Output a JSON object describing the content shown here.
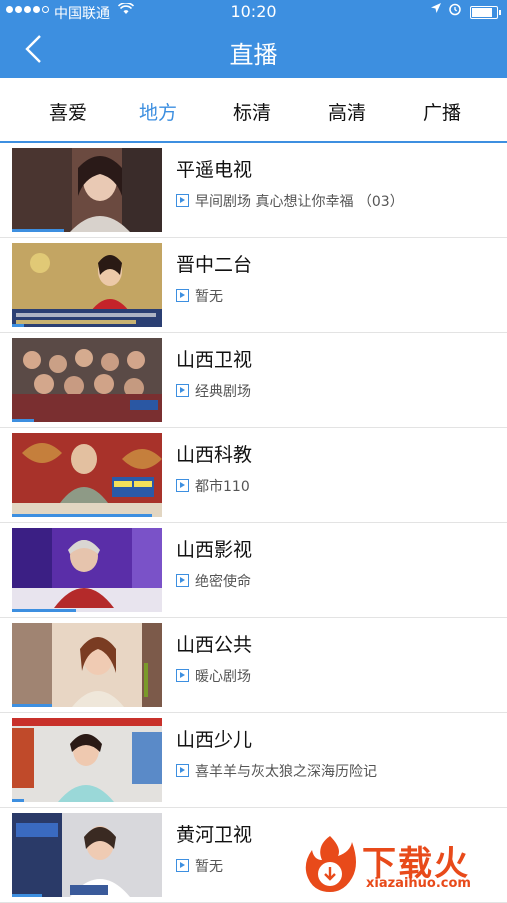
{
  "status_bar": {
    "carrier": "中国联通",
    "time": "10:20"
  },
  "header": {
    "title": "直播",
    "background": "#3d8fe0"
  },
  "tabs": [
    "喜爱",
    "地方",
    "标清",
    "高清",
    "广播"
  ],
  "active_tab": "地方",
  "channels": [
    {
      "name": "平遥电视",
      "program": "早间剧场 真心想让你幸福 （03）"
    },
    {
      "name": "晋中二台",
      "program": "暂无"
    },
    {
      "name": "山西卫视",
      "program": "经典剧场"
    },
    {
      "name": "山西科教",
      "program": "都市110"
    },
    {
      "name": "山西影视",
      "program": "绝密使命"
    },
    {
      "name": "山西公共",
      "program": "暖心剧场"
    },
    {
      "name": "山西少儿",
      "program": "喜羊羊与灰太狼之深海历险记"
    },
    {
      "name": "黄河卫视",
      "program": "暂无"
    }
  ],
  "watermark": {
    "brand": "下载火",
    "url": "xiazaihuo.com"
  },
  "accent_color": "#3d8fe0"
}
